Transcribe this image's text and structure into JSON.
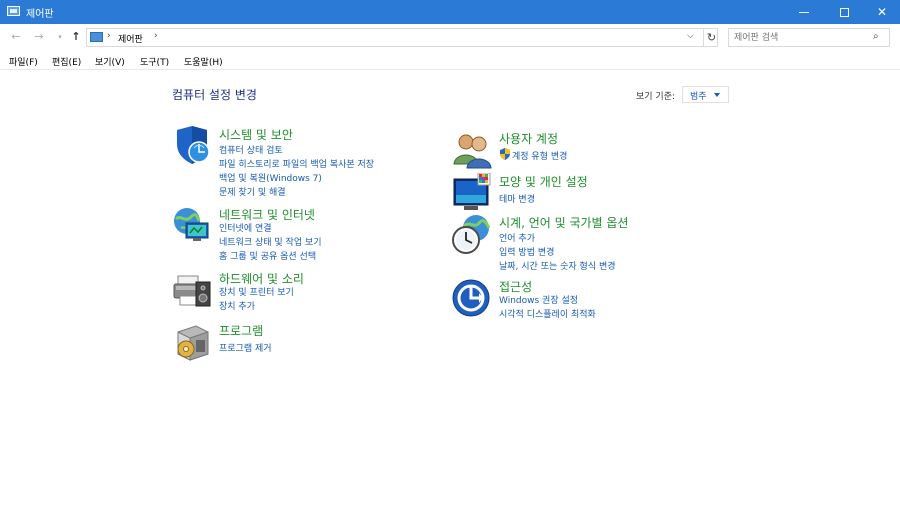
{
  "window": {
    "title": "제어판",
    "minimize": "─",
    "maximize": "□",
    "close": "✕"
  },
  "nav": {
    "back": "←",
    "forward": "→",
    "recent": "▾",
    "up": "↑",
    "breadcrumb": "제어판",
    "sep": "›",
    "dropdown": "⌵",
    "refresh": "↻",
    "search_placeholder": "제어판 검색",
    "search_icon": "⌕"
  },
  "menu": [
    "파일(F)",
    "편집(E)",
    "보기(V)",
    "도구(T)",
    "도움말(H)"
  ],
  "page": {
    "title": "컴퓨터 설정 변경",
    "view_by_label": "보기 기준:",
    "view_by_value": "범주"
  },
  "categories_left": [
    {
      "title": "시스템 및 보안",
      "icon": "shield-icon",
      "links": [
        "컴퓨터 상태 검토",
        "파일 히스토리로 파일의 백업 복사본 저장",
        "백업 및 복원(Windows 7)",
        "문제 찾기 및 해결"
      ]
    },
    {
      "title": "네트워크 및 인터넷",
      "icon": "network-globe-icon",
      "links": [
        "인터넷에 연결",
        "네트워크 상태 및 작업 보기",
        "홈 그룹 및 공유 옵션 선택"
      ]
    },
    {
      "title": "하드웨어 및 소리",
      "icon": "printer-speaker-icon",
      "links": [
        "장치 및 프린터 보기",
        "장치 추가"
      ]
    },
    {
      "title": "프로그램",
      "icon": "program-box-icon",
      "links": [
        "프로그램 제거"
      ]
    }
  ],
  "categories_right": [
    {
      "title": "사용자 계정",
      "icon": "users-icon",
      "links": [
        "계정 유형 변경"
      ]
    },
    {
      "title": "모양 및 개인 설정",
      "icon": "monitor-palette-icon",
      "links": [
        "테마 변경"
      ]
    },
    {
      "title": "시계, 언어 및 국가별 옵션",
      "icon": "clock-globe-icon",
      "links": [
        "언어 추가",
        "입력 방법 변경",
        "날짜, 시간 또는 숫자 형식 변경"
      ]
    },
    {
      "title": "접근성",
      "icon": "accessibility-icon",
      "links": [
        "Windows 권장 설정",
        "시각적 디스플레이 최적화"
      ]
    }
  ]
}
